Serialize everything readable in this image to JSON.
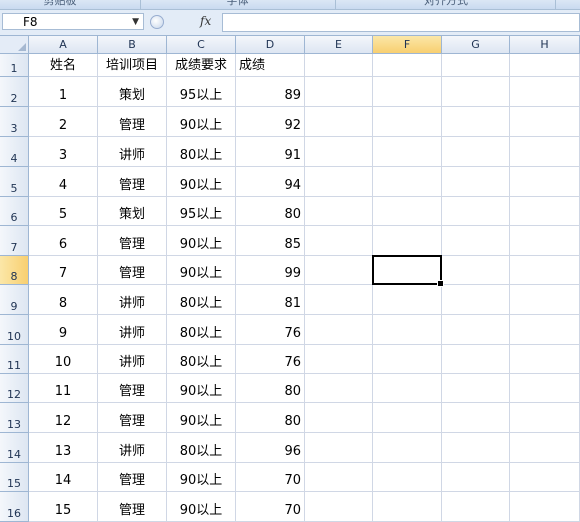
{
  "ribbon": {
    "groups": [
      "剪贴板",
      "字体",
      "对齐方式"
    ]
  },
  "formula_bar": {
    "name_box": "F8",
    "fx_label": "fx",
    "formula": ""
  },
  "columns": [
    "A",
    "B",
    "C",
    "D",
    "E",
    "F",
    "G",
    "H"
  ],
  "selected_cell": {
    "column": "F",
    "row": 8
  },
  "rows": [
    {
      "num": "1",
      "cells": [
        "姓名",
        "培训项目",
        "成绩要求",
        "成绩"
      ]
    },
    {
      "num": "2",
      "cells": [
        "1",
        "策划",
        "95以上",
        "89"
      ]
    },
    {
      "num": "3",
      "cells": [
        "2",
        "管理",
        "90以上",
        "92"
      ]
    },
    {
      "num": "4",
      "cells": [
        "3",
        "讲师",
        "80以上",
        "91"
      ]
    },
    {
      "num": "5",
      "cells": [
        "4",
        "管理",
        "90以上",
        "94"
      ]
    },
    {
      "num": "6",
      "cells": [
        "5",
        "策划",
        "95以上",
        "80"
      ]
    },
    {
      "num": "7",
      "cells": [
        "6",
        "管理",
        "90以上",
        "85"
      ]
    },
    {
      "num": "8",
      "cells": [
        "7",
        "管理",
        "90以上",
        "99"
      ]
    },
    {
      "num": "9",
      "cells": [
        "8",
        "讲师",
        "80以上",
        "81"
      ]
    },
    {
      "num": "10",
      "cells": [
        "9",
        "讲师",
        "80以上",
        "76"
      ]
    },
    {
      "num": "11",
      "cells": [
        "10",
        "讲师",
        "80以上",
        "76"
      ]
    },
    {
      "num": "12",
      "cells": [
        "11",
        "管理",
        "90以上",
        "80"
      ]
    },
    {
      "num": "13",
      "cells": [
        "12",
        "管理",
        "90以上",
        "80"
      ]
    },
    {
      "num": "14",
      "cells": [
        "13",
        "讲师",
        "80以上",
        "96"
      ]
    },
    {
      "num": "15",
      "cells": [
        "14",
        "管理",
        "90以上",
        "70"
      ]
    },
    {
      "num": "16",
      "cells": [
        "15",
        "管理",
        "90以上",
        "70"
      ]
    }
  ]
}
